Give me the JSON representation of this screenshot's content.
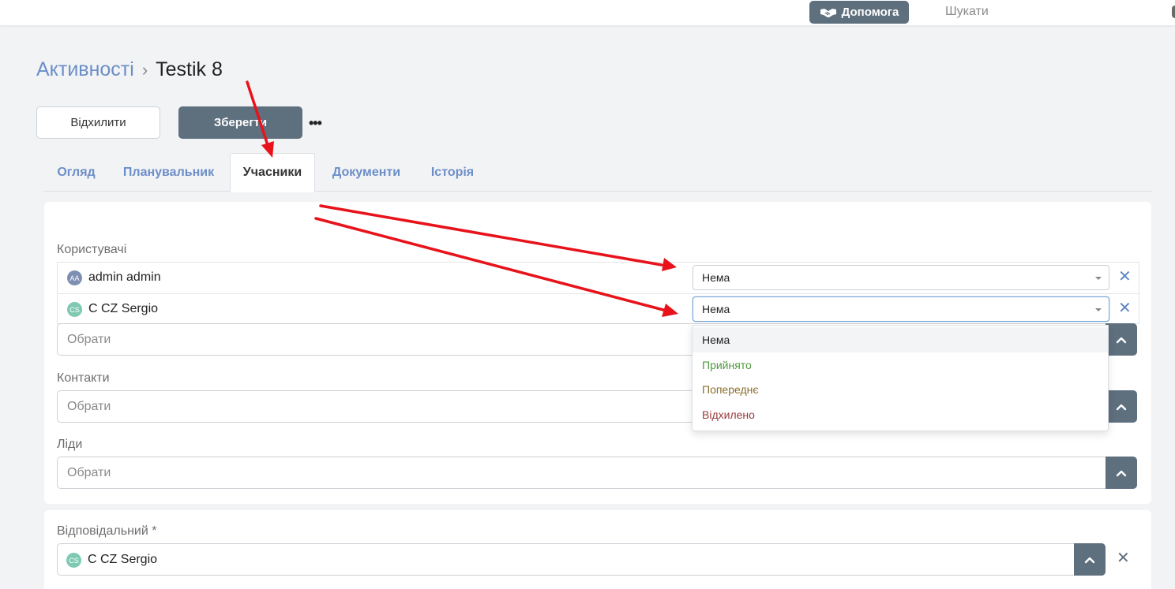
{
  "topbar": {
    "help_label": "Допомога",
    "search_placeholder": "Шукати"
  },
  "breadcrumb": {
    "parent": "Активності",
    "separator": "›",
    "current": "Testik 8"
  },
  "actions": {
    "reject_label": "Відхилити",
    "save_label": "Зберегти",
    "more_label": "•••"
  },
  "tabs": [
    {
      "label": "Огляд",
      "active": false
    },
    {
      "label": "Планувальник",
      "active": false
    },
    {
      "label": "Учасники",
      "active": true
    },
    {
      "label": "Документи",
      "active": false
    },
    {
      "label": "Історія",
      "active": false
    }
  ],
  "users": {
    "label": "Користувачі",
    "rows": [
      {
        "initials": "AA",
        "avatar_color": "#7e8fb3",
        "name": "admin admin",
        "status": "Нема"
      },
      {
        "initials": "CS",
        "avatar_color": "#7fc9b2",
        "name": "C CZ Sergio",
        "status": "Нема"
      }
    ],
    "placeholder": "Обрати"
  },
  "status_dropdown": {
    "options": [
      {
        "label": "Нема",
        "color": "#222222"
      },
      {
        "label": "Прийнято",
        "color": "#4e9a3e"
      },
      {
        "label": "Попереднє",
        "color": "#8a6d2b"
      },
      {
        "label": "Відхилено",
        "color": "#9a3a3a"
      }
    ]
  },
  "contacts": {
    "label": "Контакти",
    "placeholder": "Обрати"
  },
  "leads": {
    "label": "Ліди",
    "placeholder": "Обрати"
  },
  "responsible": {
    "label": "Відповідальний *",
    "initials": "CS",
    "avatar_color": "#7fc9b2",
    "name": "C CZ Sergio"
  },
  "colors": {
    "accent": "#5e6f7e",
    "link": "#6c8ec8",
    "annotation_arrow": "#e8121b"
  }
}
